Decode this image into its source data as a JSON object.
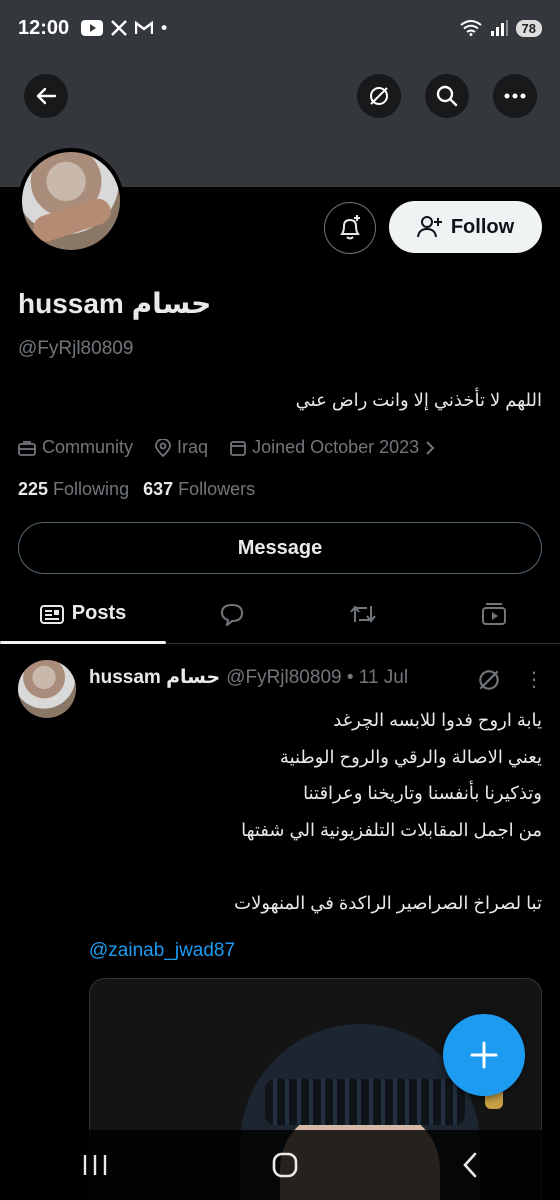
{
  "status_bar": {
    "time": "12:00",
    "battery": "78",
    "dot": "•"
  },
  "profile": {
    "name": "hussam حسام",
    "handle": "@FyRjl80809",
    "bio": "اللهم لا تأخذني إلا وانت راض عني",
    "category": "Community",
    "location": "Iraq",
    "joined": "Joined October 2023",
    "following_count": "225",
    "following_label": "Following",
    "followers_count": "637",
    "followers_label": "Followers"
  },
  "buttons": {
    "follow": "Follow",
    "message": "Message"
  },
  "tabs": {
    "posts": "Posts"
  },
  "post": {
    "author": "hussam حسام",
    "meta": "@FyRjl80809 • 11 Jul",
    "more": "⋮",
    "lines": [
      "يابة اروح فدوا للابسه الچرغد",
      "يعني الاصالة والرقي والروح الوطنية",
      "وتذكيرنا بأنفسنا وتاريخنا وعراقتنا",
      "من اجمل المقابلات التلفزيونية الي شفتها",
      "",
      "تبا لصراخ الصراصير الراكدة في المنهولات"
    ],
    "mention": "@zainab_jwad87"
  },
  "colors": {
    "accent": "#1d9bf0",
    "header_bg": "#34383c",
    "muted": "#71767b"
  }
}
